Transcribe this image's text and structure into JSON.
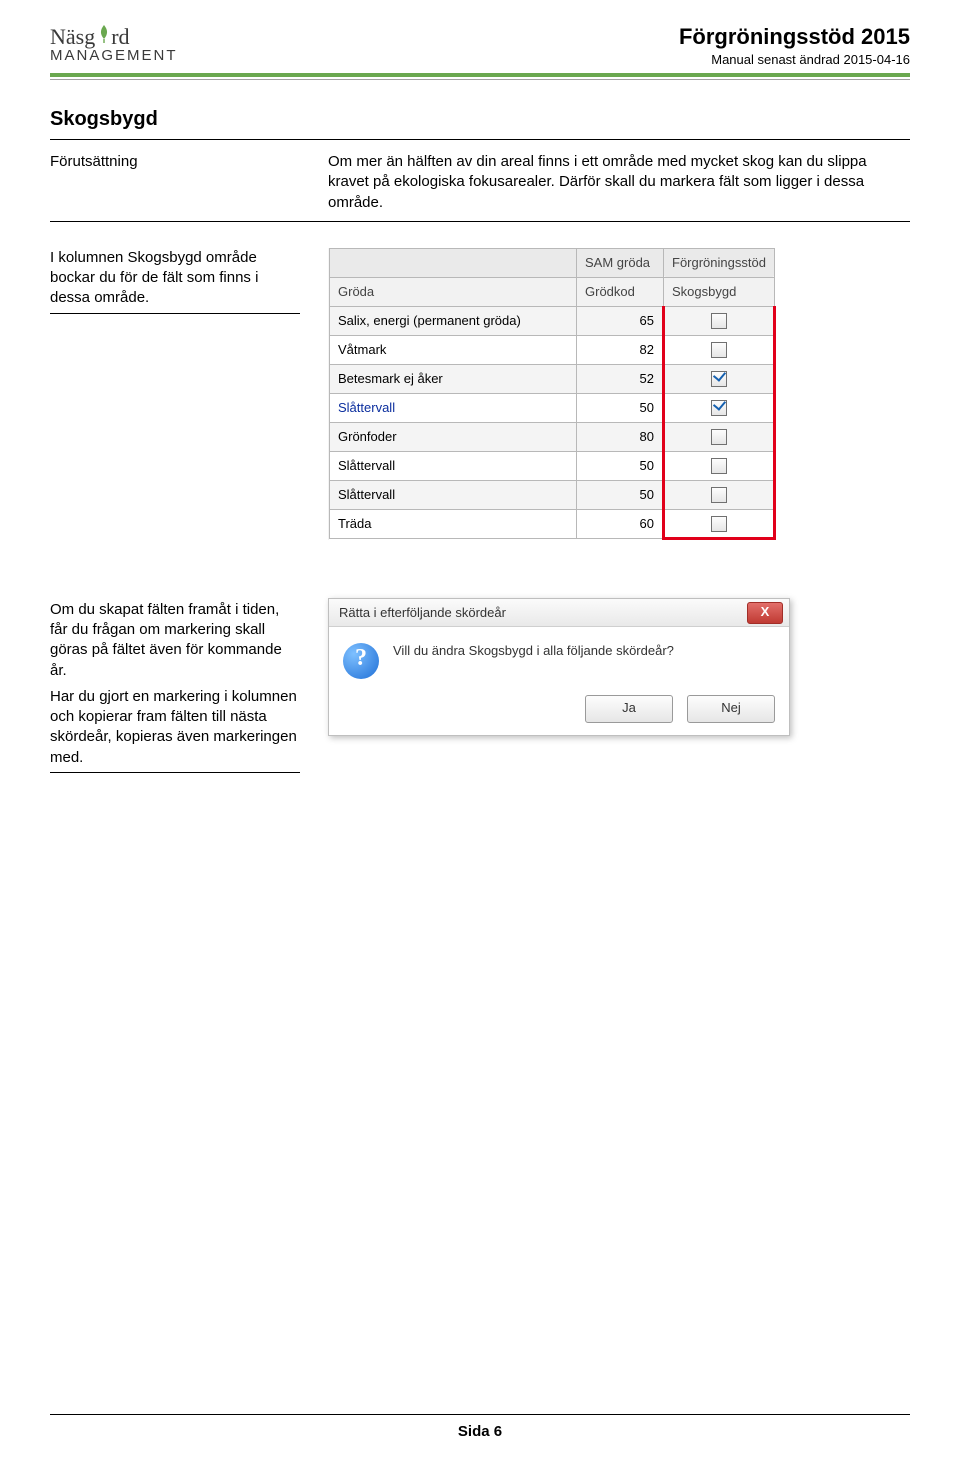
{
  "header": {
    "brand_top_a": "Näsg",
    "brand_top_b": "rd",
    "brand_bottom": "MANAGEMENT",
    "title": "Förgröningsstöd 2015",
    "subtitle": "Manual senast ändrad 2015-04-16"
  },
  "section": {
    "heading": "Skogsbygd",
    "precond_label": "Förutsättning",
    "precond_text": "Om mer än hälften av din areal finns i ett område med mycket skog kan du slippa kravet på ekologiska fokusarealer. Därför skall du markera fält som ligger i dessa område."
  },
  "block1": {
    "left": "I kolumnen Skogsbygd område bockar du för de fält som finns i dessa område.",
    "grid": {
      "head_group1": "SAM gröda",
      "head_group2": "Förgröningsstöd",
      "head_col1": "Gröda",
      "head_col2": "Grödkod",
      "head_col3": "Skogsbygd",
      "rows": [
        {
          "name": "Salix, energi (permanent gröda)",
          "code": "65",
          "chk": false,
          "link": false
        },
        {
          "name": "Våtmark",
          "code": "82",
          "chk": false,
          "link": false
        },
        {
          "name": "Betesmark ej åker",
          "code": "52",
          "chk": true,
          "link": false
        },
        {
          "name": "Slåttervall",
          "code": "50",
          "chk": true,
          "link": true
        },
        {
          "name": "Grönfoder",
          "code": "80",
          "chk": false,
          "link": false
        },
        {
          "name": "Slåttervall",
          "code": "50",
          "chk": false,
          "link": false
        },
        {
          "name": "Slåttervall",
          "code": "50",
          "chk": false,
          "link": false
        },
        {
          "name": "Träda",
          "code": "60",
          "chk": false,
          "link": false
        }
      ]
    }
  },
  "block2": {
    "left_a": "Om du skapat fälten framåt i tiden, får du frågan om markering skall göras på fältet även för kommande år.",
    "left_b": "Har du gjort en markering i kolumnen och kopierar fram fälten till nästa skördeår, kopieras även markeringen med.",
    "dialog": {
      "title": "Rätta i efterföljande skördeår",
      "message": "Vill du ändra Skogsbygd i alla följande skördeår?",
      "yes": "Ja",
      "no": "Nej",
      "close": "X"
    }
  },
  "footer": {
    "page": "Sida 6"
  }
}
